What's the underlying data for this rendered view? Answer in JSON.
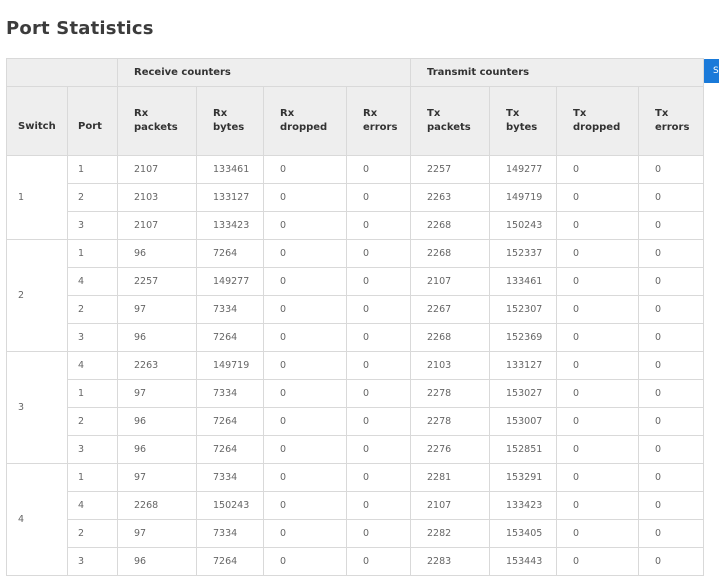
{
  "title": "Port Statistics",
  "side_button": {
    "label": "S"
  },
  "headers": {
    "switch": "Switch",
    "port": "Port",
    "receive_group": "Receive counters",
    "transmit_group": "Transmit counters",
    "rx_packets": [
      "Rx",
      "packets"
    ],
    "rx_bytes": [
      "Rx",
      "bytes"
    ],
    "rx_dropped": [
      "Rx",
      "dropped"
    ],
    "rx_errors": [
      "Rx",
      "errors"
    ],
    "tx_packets": [
      "Tx",
      "packets"
    ],
    "tx_bytes": [
      "Tx",
      "bytes"
    ],
    "tx_dropped": [
      "Tx",
      "dropped"
    ],
    "tx_errors": [
      "Tx",
      "errors"
    ]
  },
  "groups": [
    {
      "switch": "1",
      "rows": [
        [
          "1",
          "2107",
          "133461",
          "0",
          "0",
          "2257",
          "149277",
          "0",
          "0"
        ],
        [
          "2",
          "2103",
          "133127",
          "0",
          "0",
          "2263",
          "149719",
          "0",
          "0"
        ],
        [
          "3",
          "2107",
          "133423",
          "0",
          "0",
          "2268",
          "150243",
          "0",
          "0"
        ]
      ]
    },
    {
      "switch": "2",
      "rows": [
        [
          "1",
          "96",
          "7264",
          "0",
          "0",
          "2268",
          "152337",
          "0",
          "0"
        ],
        [
          "4",
          "2257",
          "149277",
          "0",
          "0",
          "2107",
          "133461",
          "0",
          "0"
        ],
        [
          "2",
          "97",
          "7334",
          "0",
          "0",
          "2267",
          "152307",
          "0",
          "0"
        ],
        [
          "3",
          "96",
          "7264",
          "0",
          "0",
          "2268",
          "152369",
          "0",
          "0"
        ]
      ]
    },
    {
      "switch": "3",
      "rows": [
        [
          "4",
          "2263",
          "149719",
          "0",
          "0",
          "2103",
          "133127",
          "0",
          "0"
        ],
        [
          "1",
          "97",
          "7334",
          "0",
          "0",
          "2278",
          "153027",
          "0",
          "0"
        ],
        [
          "2",
          "96",
          "7264",
          "0",
          "0",
          "2278",
          "153007",
          "0",
          "0"
        ],
        [
          "3",
          "96",
          "7264",
          "0",
          "0",
          "2276",
          "152851",
          "0",
          "0"
        ]
      ]
    },
    {
      "switch": "4",
      "rows": [
        [
          "1",
          "97",
          "7334",
          "0",
          "0",
          "2281",
          "153291",
          "0",
          "0"
        ],
        [
          "4",
          "2268",
          "150243",
          "0",
          "0",
          "2107",
          "133423",
          "0",
          "0"
        ],
        [
          "2",
          "97",
          "7334",
          "0",
          "0",
          "2282",
          "153405",
          "0",
          "0"
        ],
        [
          "3",
          "96",
          "7264",
          "0",
          "0",
          "2283",
          "153443",
          "0",
          "0"
        ]
      ]
    }
  ]
}
